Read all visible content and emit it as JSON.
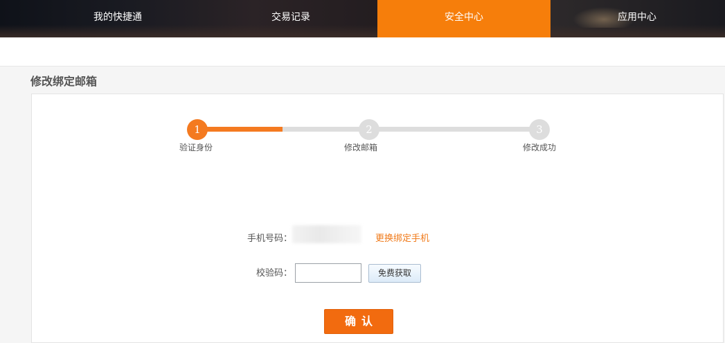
{
  "topnav": {
    "items": [
      {
        "label": "我的快捷通",
        "active": false
      },
      {
        "label": "交易记录",
        "active": false
      },
      {
        "label": "安全中心",
        "active": true
      },
      {
        "label": "应用中心",
        "active": false
      }
    ],
    "active_color": "#f67e0b"
  },
  "page": {
    "title": "修改绑定邮箱"
  },
  "stepper": {
    "steps": [
      {
        "number": "1",
        "label": "验证身份",
        "state": "current"
      },
      {
        "number": "2",
        "label": "修改邮箱",
        "state": "pending"
      },
      {
        "number": "3",
        "label": "修改成功",
        "state": "pending"
      }
    ],
    "accent_color": "#f47a20"
  },
  "form": {
    "phone_label": "手机号码：",
    "change_phone_link": "更换绑定手机",
    "code_label": "校验码：",
    "code_value": "",
    "get_code_button": "免费获取",
    "confirm_button": "确认"
  }
}
